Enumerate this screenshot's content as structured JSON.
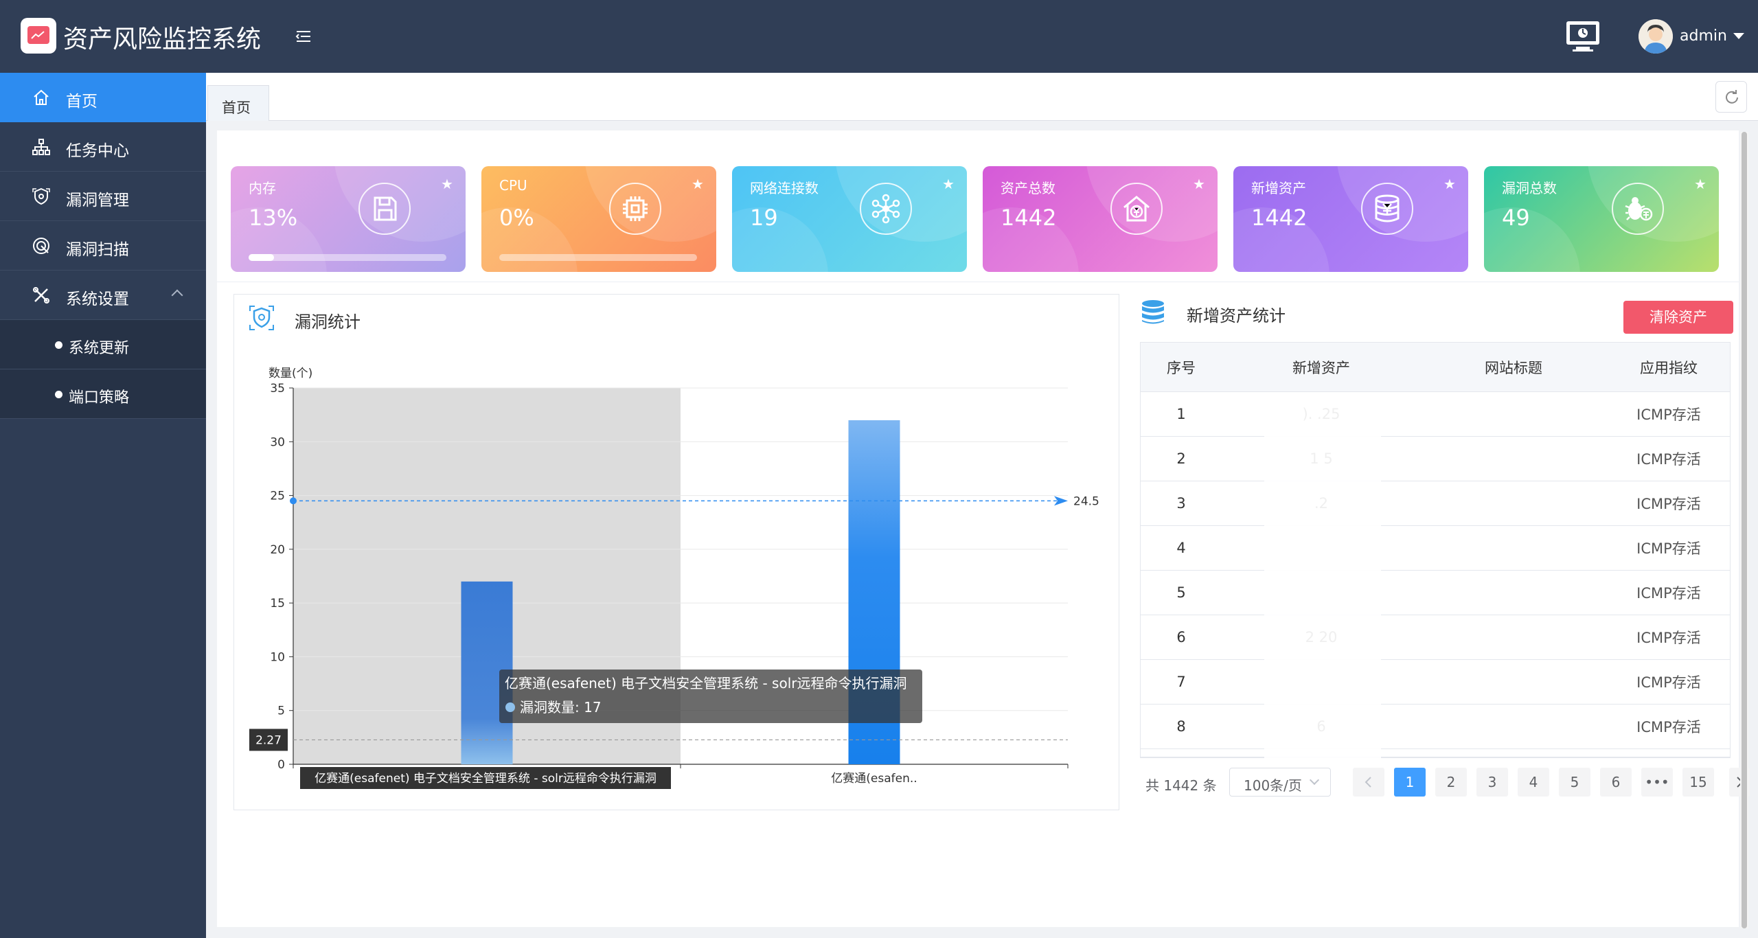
{
  "app": {
    "title": "资产风险监控系统",
    "user": "admin"
  },
  "sidebar": {
    "items": [
      {
        "label": "首页"
      },
      {
        "label": "任务中心"
      },
      {
        "label": "漏洞管理"
      },
      {
        "label": "漏洞扫描"
      },
      {
        "label": "系统设置"
      }
    ],
    "sub_items": [
      {
        "label": "系统更新"
      },
      {
        "label": "端口策略"
      }
    ]
  },
  "tabs": [
    {
      "label": "首页"
    }
  ],
  "cards": [
    {
      "label": "内存",
      "value": "13%",
      "progress": 0.13,
      "icon": "save-icon"
    },
    {
      "label": "CPU",
      "value": "0%",
      "progress": 0.0,
      "icon": "cpu-chip-icon"
    },
    {
      "label": "网络连接数",
      "value": "19",
      "icon": "network-nodes-icon"
    },
    {
      "label": "资产总数",
      "value": "1442",
      "icon": "house-yen-icon"
    },
    {
      "label": "新增资产",
      "value": "1442",
      "icon": "coin-stack-icon"
    },
    {
      "label": "漏洞总数",
      "value": "49",
      "icon": "bug-icon"
    }
  ],
  "vuln_panel": {
    "title": "漏洞统计"
  },
  "chart_data": {
    "type": "bar",
    "ylabel": "数量(个)",
    "ylim": [
      0,
      35
    ],
    "yticks": [
      "0",
      "5",
      "10",
      "15",
      "20",
      "25",
      "30",
      "35"
    ],
    "categories": [
      "亿赛通(esafenet) 电子文档安全管理系统 - solr远程命令执行漏洞",
      "亿赛通(esafen.."
    ],
    "series": [
      {
        "name": "漏洞数量",
        "values": [
          17,
          32
        ]
      }
    ],
    "markline_avg": {
      "value": 24.5,
      "label": "24.5"
    },
    "markline_min": {
      "value": 2.27,
      "label": "2.27"
    },
    "tooltip": {
      "title": "亿赛通(esafenet) 电子文档安全管理系统 - solr远程命令执行漏洞",
      "line": "漏洞数量: 17"
    },
    "axis_tooltip_label": "亿赛通(esafenet) 电子文档安全管理系统 - solr远程命令执行漏洞"
  },
  "asset_panel": {
    "title": "新增资产统计",
    "clear_button": "清除资产",
    "columns": [
      "序号",
      "新增资产",
      "网站标题",
      "应用指纹"
    ],
    "rows": [
      {
        "idx": "1",
        "asset": ").  .25",
        "title": "",
        "fp": "ICMP存活"
      },
      {
        "idx": "2",
        "asset": "1     5",
        "title": "",
        "fp": "ICMP存活"
      },
      {
        "idx": "3",
        "asset": "  .2",
        "title": "",
        "fp": "ICMP存活"
      },
      {
        "idx": "4",
        "asset": "",
        "title": "",
        "fp": "ICMP存活"
      },
      {
        "idx": "5",
        "asset": "",
        "title": "",
        "fp": "ICMP存活"
      },
      {
        "idx": "6",
        "asset": "2       20",
        "title": "",
        "fp": "ICMP存活"
      },
      {
        "idx": "7",
        "asset": "",
        "title": "",
        "fp": "ICMP存活"
      },
      {
        "idx": "8",
        "asset": "6      ",
        "title": "",
        "fp": "ICMP存活"
      }
    ],
    "pagination": {
      "total": "共 1442 条",
      "page_size": "100条/页",
      "pages": [
        "1",
        "2",
        "3",
        "4",
        "5",
        "6",
        "•••",
        "15"
      ],
      "current": "1"
    }
  },
  "colors": {
    "header_bg": "#303e56",
    "sidebar_bg": "#2f3d55",
    "active": "#2d8cf0",
    "danger": "#f2586b"
  }
}
